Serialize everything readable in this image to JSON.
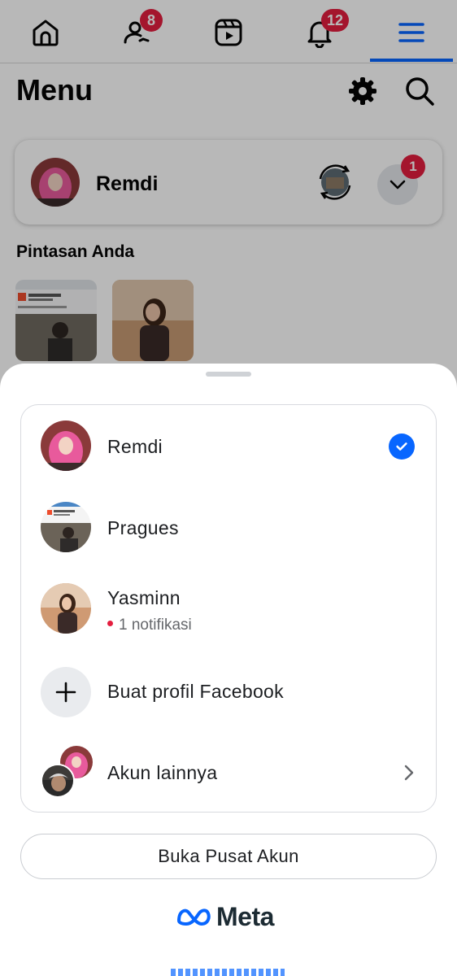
{
  "nav": {
    "friends_badge": "8",
    "notifications_badge": "12",
    "items": [
      "home-icon",
      "friends-icon",
      "reels-icon",
      "bell-icon",
      "menu-icon"
    ]
  },
  "header": {
    "title": "Menu"
  },
  "profile_card": {
    "name": "Remdi",
    "badge": "1"
  },
  "shortcuts": {
    "title": "Pintasan Anda"
  },
  "sheet": {
    "accounts": [
      {
        "name": "Remdi",
        "selected": true
      },
      {
        "name": "Pragues"
      },
      {
        "name": "Yasminn",
        "notification": "1 notifikasi"
      }
    ],
    "create_profile_label": "Buat profil Facebook",
    "other_accounts_label": "Akun lainnya",
    "account_center_button": "Buka Pusat Akun",
    "brand": "Meta"
  },
  "colors": {
    "accent": "#0866ff",
    "badge": "#e41e3f"
  }
}
